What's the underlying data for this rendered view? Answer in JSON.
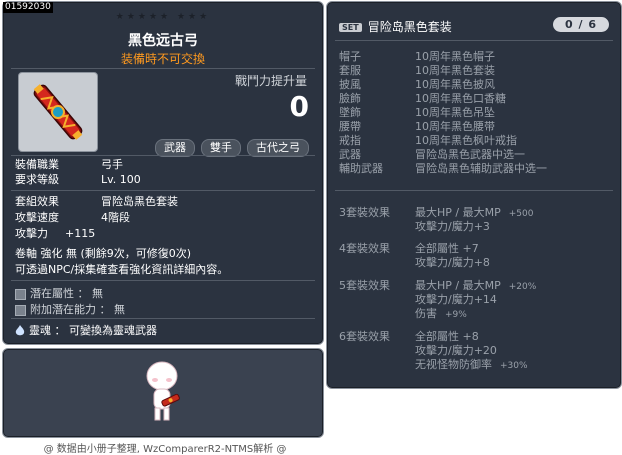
{
  "item_id": "01592030",
  "stars": "★★★★★ ★★★",
  "item_name": "黑色远古弓",
  "trade_note": "装備時不可交換",
  "power_label": "戰鬥力提升量",
  "power_value": "0",
  "tags": [
    "武器",
    "雙手",
    "古代之弓"
  ],
  "info": {
    "job_label": "裝備職業",
    "job_value": "弓手",
    "level_label": "要求等級",
    "level_value": "Lv. 100",
    "set_label": "套組效果",
    "set_value": "冒险岛黑色套装",
    "speed_label": "攻擊速度",
    "speed_value": "4階段",
    "atk_label": "攻擊力",
    "atk_value": "+115",
    "scroll_line": "卷軸 強化 無 (剩餘9次，可修復0次)",
    "npc_line": "可透過NPC/採集確查看強化資訊詳細內容。",
    "pot_label": "潛在屬性",
    "pot_value": "無",
    "addpot_label": "附加潛在能力",
    "addpot_value": "無",
    "soul_label": "靈魂",
    "soul_value": "可變換為靈魂武器"
  },
  "set_panel": {
    "badge": "SET",
    "title": "冒险岛黑色套装",
    "count": "0 / 6",
    "pieces": [
      {
        "k": "帽子",
        "v": "10周年黑色帽子"
      },
      {
        "k": "套服",
        "v": "10周年黑色套装"
      },
      {
        "k": "披風",
        "v": "10周年黑色披风"
      },
      {
        "k": "臉飾",
        "v": "10周年黑色口香糖"
      },
      {
        "k": "墜飾",
        "v": "10周年黑色吊坠"
      },
      {
        "k": "腰帶",
        "v": "10周年黑色腰带"
      },
      {
        "k": "戒指",
        "v": "10周年黑色枫叶戒指"
      },
      {
        "k": "武器",
        "v": "冒险岛黑色武器中选一"
      },
      {
        "k": "輔助武器",
        "v": "冒险岛黑色辅助武器中选一"
      }
    ],
    "bonuses": [
      {
        "title": "3套裝效果",
        "lines": [
          {
            "t": "最大HP / 最大MP",
            "v": "+500"
          },
          {
            "t": "攻擊力/魔力+3",
            "v": ""
          }
        ]
      },
      {
        "title": "4套裝效果",
        "lines": [
          {
            "t": "全部屬性 +7",
            "v": ""
          },
          {
            "t": "攻擊力/魔力+8",
            "v": ""
          }
        ]
      },
      {
        "title": "5套裝效果",
        "lines": [
          {
            "t": "最大HP / 最大MP",
            "v": "+20%"
          },
          {
            "t": "攻擊力/魔力+14",
            "v": ""
          },
          {
            "t": "伤害",
            "v": "+9%"
          }
        ]
      },
      {
        "title": "6套裝效果",
        "lines": [
          {
            "t": "全部屬性 +8",
            "v": ""
          },
          {
            "t": "攻擊力/魔力+20",
            "v": ""
          },
          {
            "t": "无视怪物防御率",
            "v": "+30%"
          }
        ]
      }
    ]
  },
  "footer": "@ 数据由小册子整理, WzComparerR2-NTMS解析 @",
  "colors": {
    "panel_bg": "#2b3340",
    "orange": "#ff9a1f",
    "muted": "#9aa1aa"
  }
}
